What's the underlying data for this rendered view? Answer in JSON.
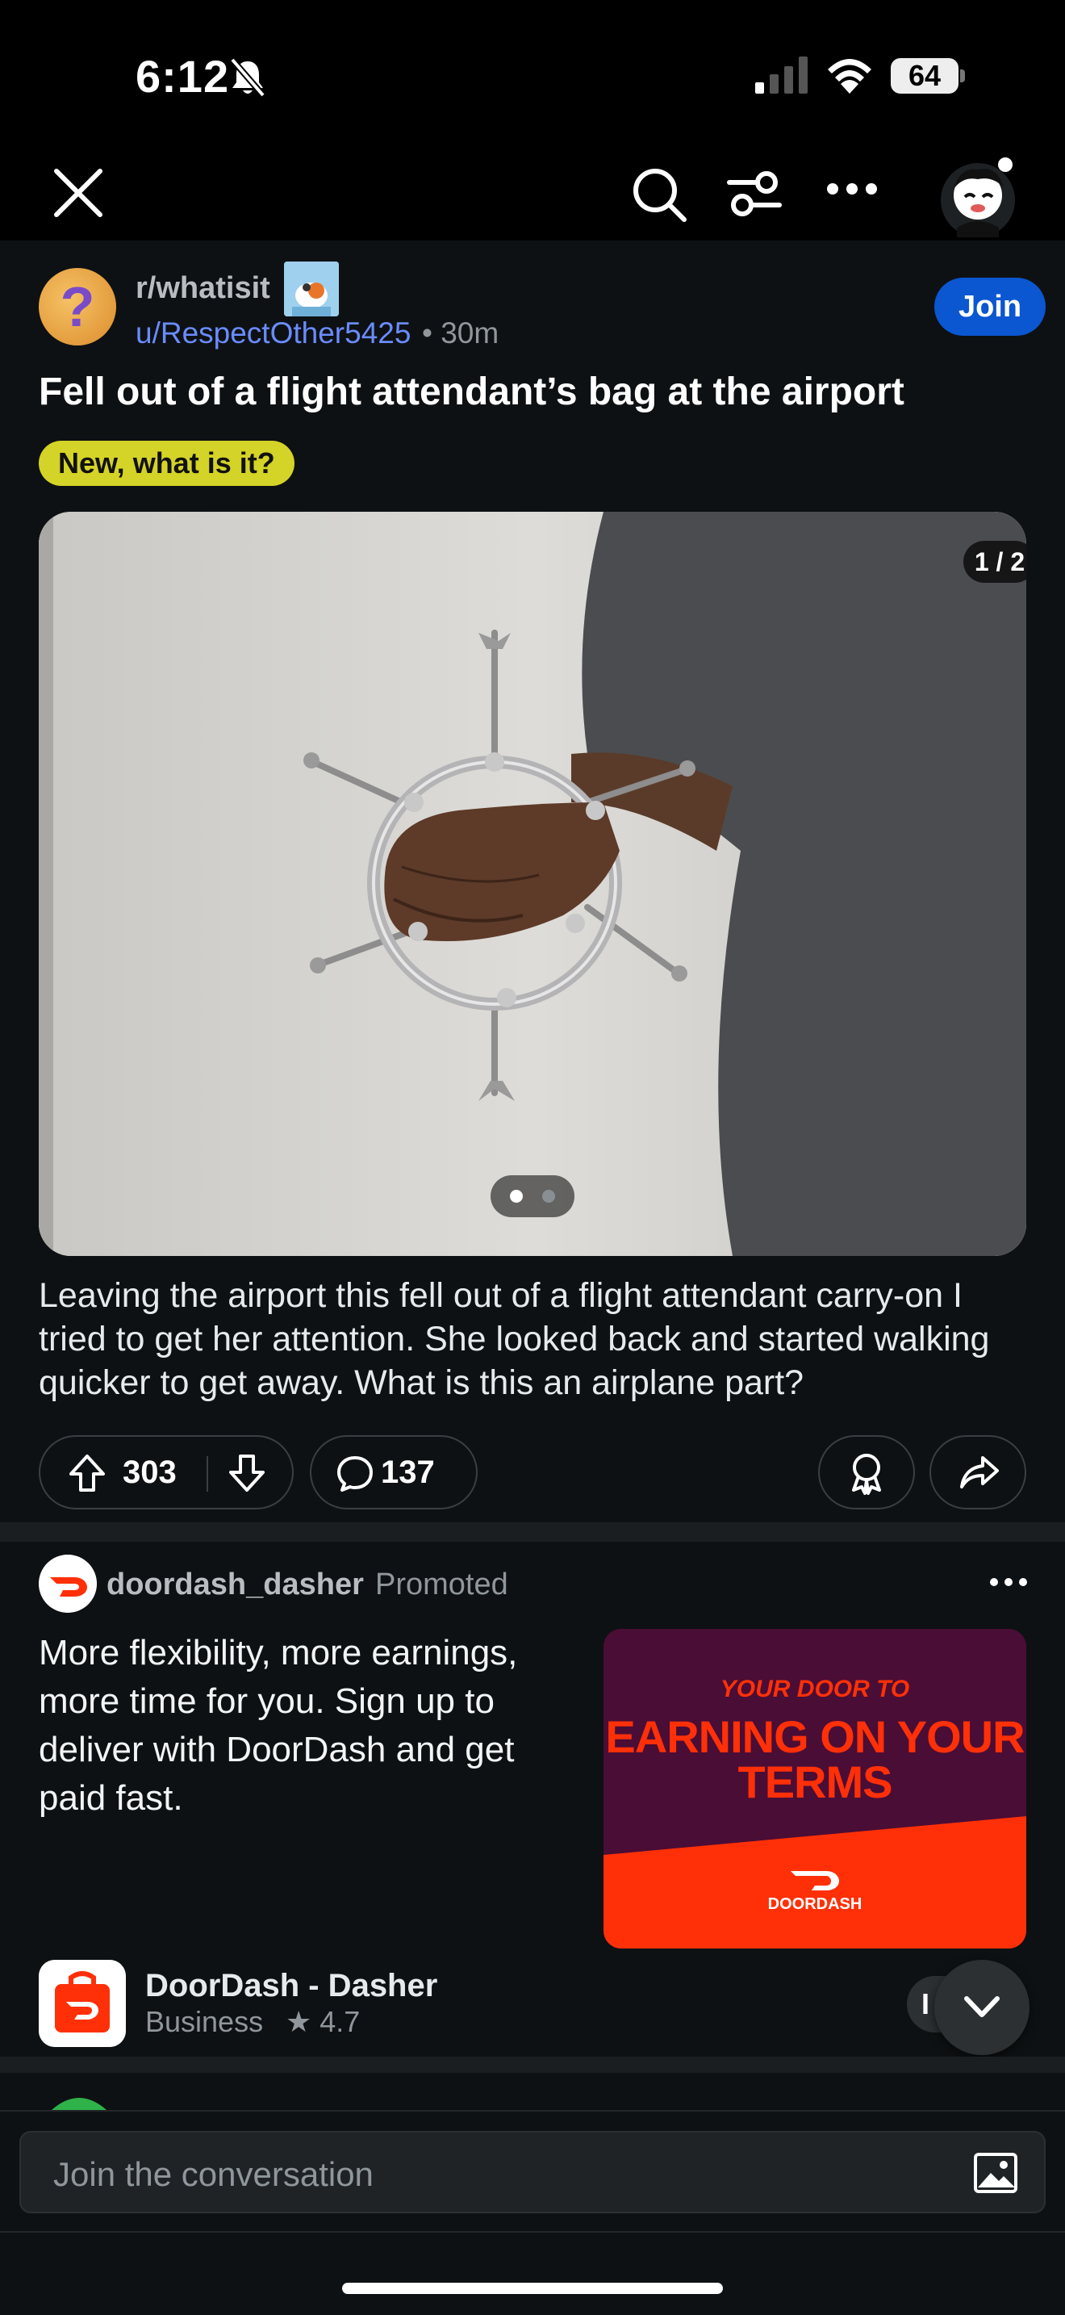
{
  "status_bar": {
    "time": "6:12",
    "battery": "64"
  },
  "nav": {
    "icons": [
      "close-icon",
      "search-icon",
      "filter-icon",
      "more-icon",
      "avatar"
    ]
  },
  "post": {
    "subreddit": "r/whatisit",
    "author": "u/RespectOther5425",
    "time": "• 30m",
    "join_label": "Join",
    "title": "Fell out of a flight attendant’s bag at the airport",
    "flair": "New, what is it?",
    "media_counter": "1 / 2",
    "media_page": 1,
    "media_total": 2,
    "body": "Leaving the airport this fell out of a flight attendant carry-on I tried to get her attention. She looked back and started walking quicker to get away. What is this an airplane part?",
    "upvotes": "303",
    "comments": "137"
  },
  "ad": {
    "advertiser": "doordash_dasher",
    "promoted_label": "Promoted",
    "text": "More flexibility, more earnings, more time for you. Sign up to deliver with DoorDash and get paid fast.",
    "image_top": "YOUR DOOR TO",
    "image_main": "EARNING ON YOUR TERMS",
    "image_brand": "DOORDASH",
    "app_name": "DoorDash - Dasher",
    "app_category": "Business",
    "app_rating": "★ 4.7",
    "install_peek": "I",
    "brand_color": "#ff3008"
  },
  "composer": {
    "placeholder": "Join the conversation"
  },
  "colors": {
    "background": "#0e1113",
    "join": "#0b56d1",
    "flair": "#d4d327",
    "link": "#6a8cff"
  }
}
